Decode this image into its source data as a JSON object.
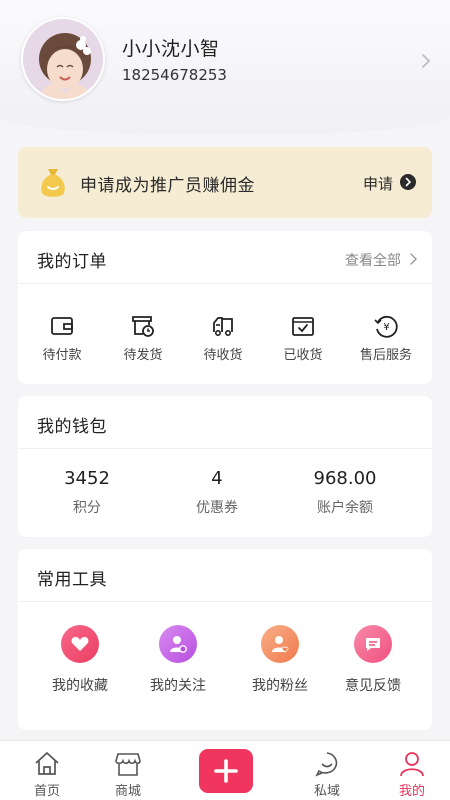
{
  "profile": {
    "name": "小小沈小智",
    "phone": "18254678253"
  },
  "promo": {
    "text": "申请成为推广员赚佣金",
    "apply_label": "申请",
    "accent": "#f6ecd4"
  },
  "orders": {
    "title": "我的订单",
    "view_all": "查看全部",
    "items": [
      {
        "label": "待付款",
        "icon": "wallet-icon"
      },
      {
        "label": "待发货",
        "icon": "package-clock-icon"
      },
      {
        "label": "待收货",
        "icon": "truck-icon"
      },
      {
        "label": "已收货",
        "icon": "box-check-icon"
      },
      {
        "label": "售后服务",
        "icon": "yuan-refund-icon"
      }
    ]
  },
  "wallet": {
    "title": "我的钱包",
    "items": [
      {
        "value": "3452",
        "label": "积分"
      },
      {
        "value": "4",
        "label": "优惠券"
      },
      {
        "value": "968.00",
        "label": "账户余额"
      }
    ]
  },
  "tools": {
    "title": "常用工具",
    "items": [
      {
        "label": "我的收藏",
        "icon": "heart-icon",
        "color": "#f0436b"
      },
      {
        "label": "我的关注",
        "icon": "user-follow-icon",
        "color": "#c35ee8"
      },
      {
        "label": "我的粉丝",
        "icon": "user-heart-icon",
        "color": "#f58f5a"
      },
      {
        "label": "意见反馈",
        "icon": "chat-bubble-icon",
        "color": "#f55f8e"
      }
    ]
  },
  "tabbar": {
    "items": [
      {
        "label": "首页",
        "icon": "home-icon"
      },
      {
        "label": "商城",
        "icon": "shop-icon"
      },
      {
        "label": "",
        "icon": "plus-icon"
      },
      {
        "label": "私域",
        "icon": "smile-bubble-icon"
      },
      {
        "label": "我的",
        "icon": "user-icon"
      }
    ],
    "active_color": "#e8335a",
    "plus_color": "#f0365e"
  }
}
